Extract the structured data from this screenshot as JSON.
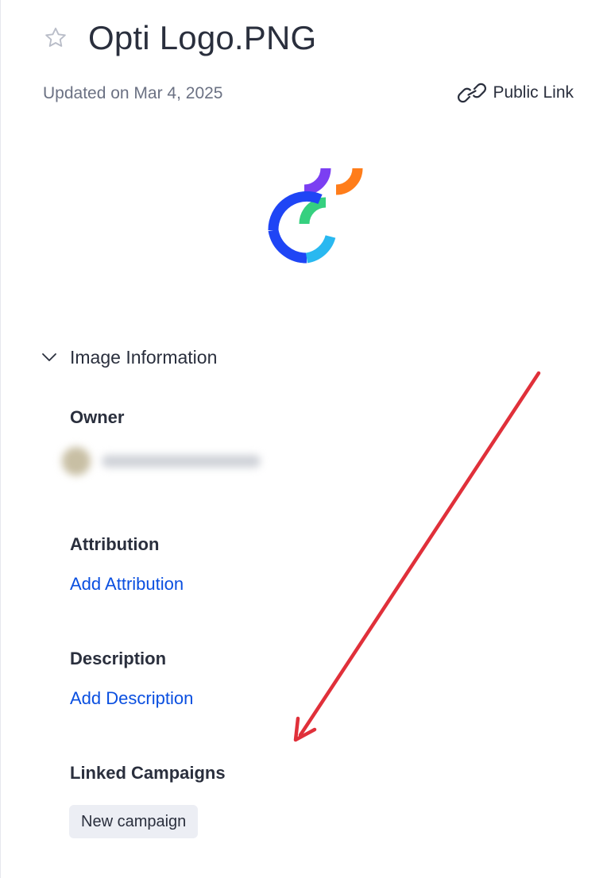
{
  "asset": {
    "title": "Opti Logo.PNG",
    "updated": "Updated on Mar 4, 2025",
    "public_link_label": "Public Link"
  },
  "image_information": {
    "section_title": "Image Information",
    "owner_label": "Owner",
    "attribution_label": "Attribution",
    "attribution_action": "Add Attribution",
    "description_label": "Description",
    "description_action": "Add Description",
    "linked_campaigns_label": "Linked Campaigns",
    "campaigns": [
      "New campaign"
    ]
  },
  "icons": {
    "favorite": "star-icon",
    "public_link": "link-icon",
    "section_toggle": "chevron-down-icon"
  },
  "colors": {
    "link": "#0a4fe0",
    "annotation_arrow": "#e0303a",
    "logo_purple": "#7b3ff2",
    "logo_orange": "#ff7d1a",
    "logo_green": "#35d07f",
    "logo_blue": "#1f45f5",
    "logo_cyan": "#29b8f0"
  }
}
